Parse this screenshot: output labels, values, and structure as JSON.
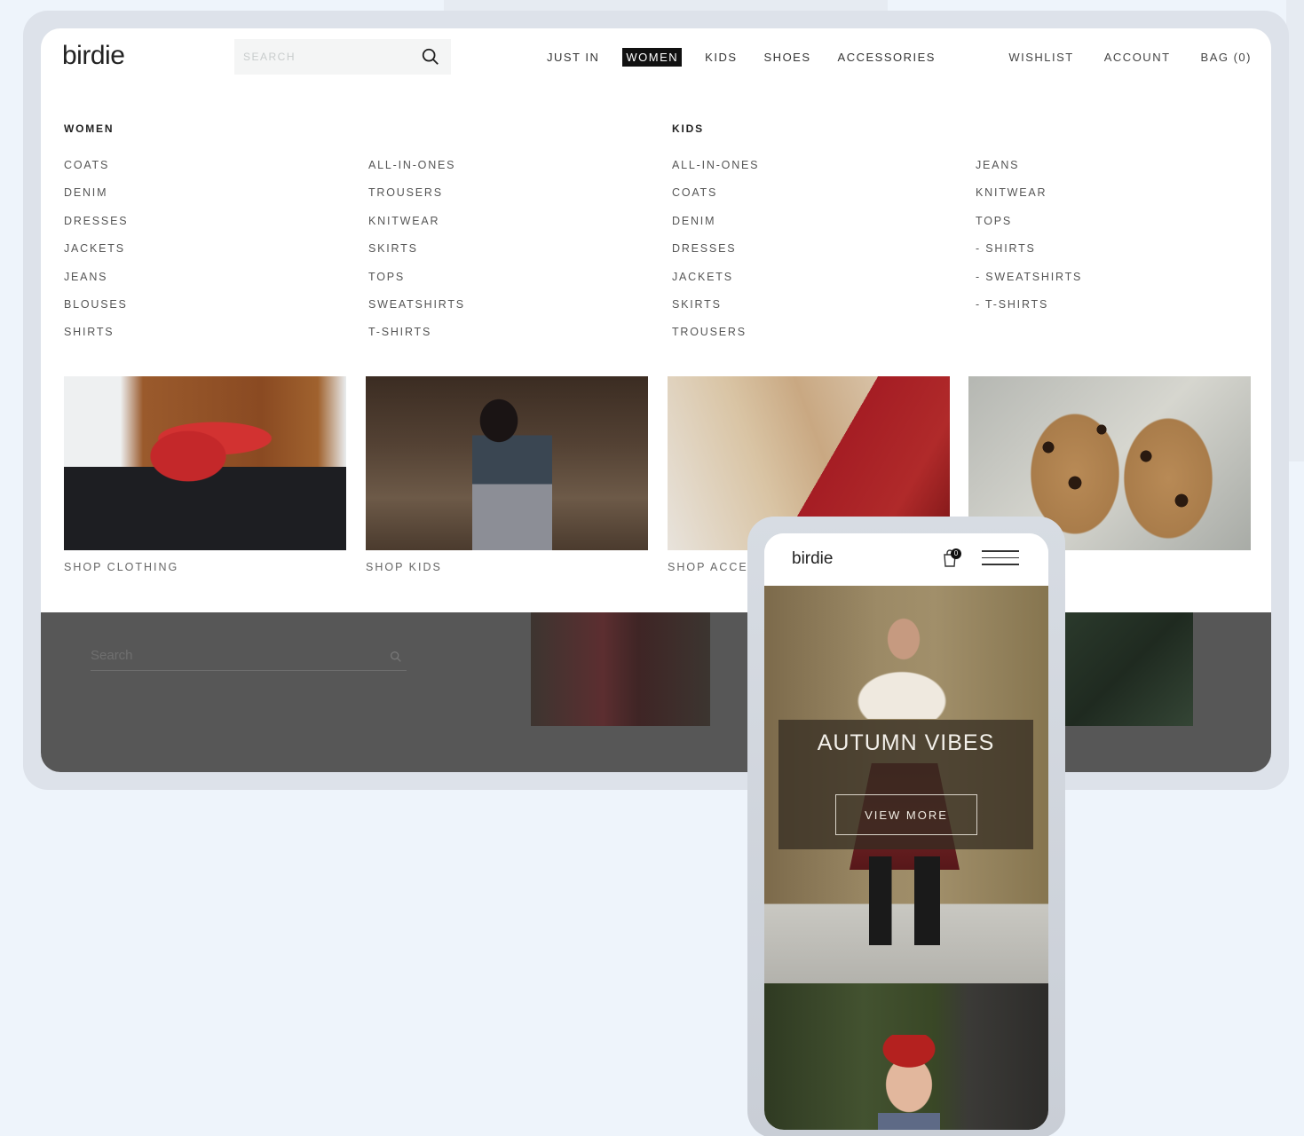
{
  "desktop": {
    "logo": "birdie",
    "search": {
      "placeholder": "SEARCH"
    },
    "main_nav": [
      "JUST IN",
      "WOMEN",
      "KIDS",
      "SHOES",
      "ACCESSORIES"
    ],
    "active_nav": "WOMEN",
    "util_nav": [
      "WISHLIST",
      "ACCOUNT",
      "BAG (0)"
    ],
    "mega_menu": {
      "women": {
        "heading": "WOMEN",
        "col1": [
          "COATS",
          "DENIM",
          "DRESSES",
          "JACKETS",
          "JEANS",
          "BLOUSES",
          "SHIRTS"
        ],
        "col2": [
          "ALL-IN-ONES",
          "TROUSERS",
          "KNITWEAR",
          "SKIRTS",
          "TOPS",
          "SWEATSHIRTS",
          "T-SHIRTS"
        ]
      },
      "kids": {
        "heading": "KIDS",
        "col1": [
          "ALL-IN-ONES",
          "COATS",
          "DENIM",
          "DRESSES",
          "JACKETS",
          "SKIRTS",
          "TROUSERS"
        ],
        "col2": [
          "JEANS",
          "KNITWEAR",
          "TOPS",
          "- SHIRTS",
          "- SWEATSHIRTS",
          "- T-SHIRTS"
        ]
      },
      "promos": [
        "SHOP CLOTHING",
        "SHOP KIDS",
        "SHOP ACCES"
      ]
    },
    "footer_search": {
      "placeholder": "Search"
    }
  },
  "mobile": {
    "logo": "birdie",
    "bag_count": "0",
    "hero": {
      "title": "AUTUMN VIBES",
      "button": "VIEW MORE"
    }
  }
}
